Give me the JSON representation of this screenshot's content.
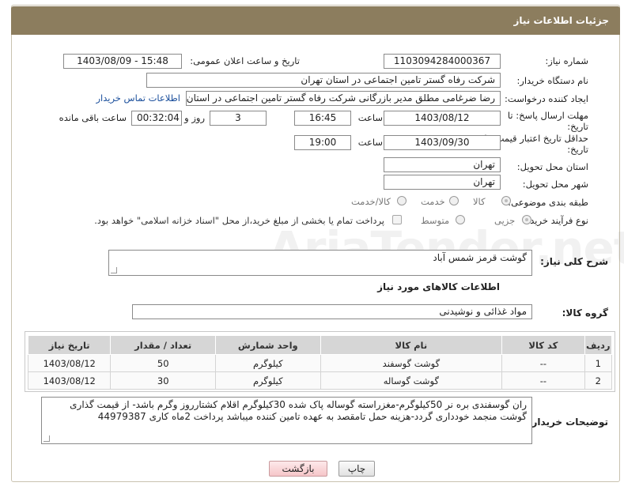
{
  "header": {
    "title": "جزئیات اطلاعات نیاز"
  },
  "watermark": "AriaTender.net",
  "form": {
    "need_number_label": "شماره نیاز:",
    "need_number": "1103094284000367",
    "announce_label": "تاریخ و ساعت اعلان عمومی:",
    "announce_value": "1403/08/09 - 15:48",
    "buyer_label": "نام دستگاه خریدار:",
    "buyer_value": "شرکت رفاه گستر تامین اجتماعی در استان تهران",
    "creator_label": "ایجاد کننده درخواست:",
    "creator_value": "رضا ضرغامی مطلق مدیر بازرگانی شرکت رفاه گستر تامین اجتماعی در استان تهران",
    "contact_link": "اطلاعات تماس خریدار",
    "deadline_label_1": "مهلت ارسال پاسخ: تا",
    "deadline_label_2": "تاریخ:",
    "deadline_date": "1403/08/12",
    "time_label": "ساعت",
    "deadline_time": "16:45",
    "days_value": "3",
    "days_label": "روز و",
    "remaining_time": "00:32:04",
    "remaining_label": "ساعت باقی مانده",
    "validity_label_1": "حداقل تاریخ اعتبار قیمت: تا",
    "validity_label_2": "تاریخ:",
    "validity_date": "1403/09/30",
    "validity_time_label": "ساعت",
    "validity_time": "19:00",
    "province_label": "استان محل تحویل:",
    "province_value": "تهران",
    "city_label": "شهر محل تحویل:",
    "city_value": "تهران",
    "category_label": "طبقه بندی موضوعی:",
    "category_options": [
      "کالا",
      "خدمت",
      "کالا/خدمت"
    ],
    "process_label": "نوع فرآیند خرید :",
    "process_options": [
      "جزیی",
      "متوسط"
    ],
    "payment_note": "پرداخت تمام یا بخشی از مبلغ خرید،از محل \"اسناد خزانه اسلامی\" خواهد بود.",
    "description_label": "شرح کلی نیاز:",
    "description_value": "گوشت قرمز شمس آباد"
  },
  "goods": {
    "section_title": "اطلاعات کالاهای مورد نیاز",
    "group_label": "گروه کالا:",
    "group_value": "مواد غذائی و نوشیدنی",
    "columns": [
      "ردیف",
      "کد کالا",
      "نام کالا",
      "واحد شمارش",
      "تعداد / مقدار",
      "تاریخ نیاز"
    ],
    "rows": [
      [
        "1",
        "--",
        "گوشت گوسفند",
        "کیلوگرم",
        "50",
        "1403/08/12"
      ],
      [
        "2",
        "--",
        "گوشت گوساله",
        "کیلوگرم",
        "30",
        "1403/08/12"
      ]
    ]
  },
  "buyer_notes": {
    "label": "توضیحات خریدار:",
    "text": "ران گوسفندی بره نر 50کیلوگرم-مغزراسته گوساله پاک شده 30کیلوگرم اقلام کشتارروز وگرم باشد- از قیمت گذاری گوشت منجمد خودداری گردد-هزینه حمل تامقصد به عهده تامین کننده میباشد پرداخت 2ماه کاری 44979387"
  },
  "buttons": {
    "print": "چاپ",
    "back": "بازگشت"
  }
}
